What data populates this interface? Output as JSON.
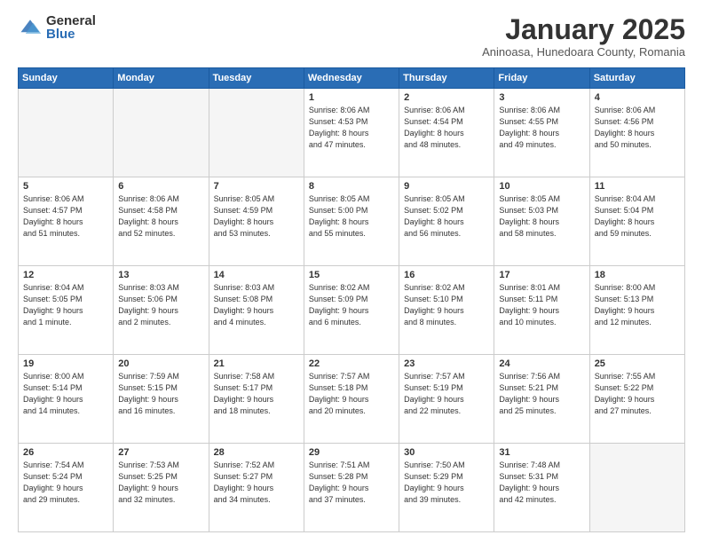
{
  "logo": {
    "general": "General",
    "blue": "Blue"
  },
  "title": "January 2025",
  "subtitle": "Aninoasa, Hunedoara County, Romania",
  "weekdays": [
    "Sunday",
    "Monday",
    "Tuesday",
    "Wednesday",
    "Thursday",
    "Friday",
    "Saturday"
  ],
  "weeks": [
    [
      {
        "day": "",
        "info": ""
      },
      {
        "day": "",
        "info": ""
      },
      {
        "day": "",
        "info": ""
      },
      {
        "day": "1",
        "info": "Sunrise: 8:06 AM\nSunset: 4:53 PM\nDaylight: 8 hours\nand 47 minutes."
      },
      {
        "day": "2",
        "info": "Sunrise: 8:06 AM\nSunset: 4:54 PM\nDaylight: 8 hours\nand 48 minutes."
      },
      {
        "day": "3",
        "info": "Sunrise: 8:06 AM\nSunset: 4:55 PM\nDaylight: 8 hours\nand 49 minutes."
      },
      {
        "day": "4",
        "info": "Sunrise: 8:06 AM\nSunset: 4:56 PM\nDaylight: 8 hours\nand 50 minutes."
      }
    ],
    [
      {
        "day": "5",
        "info": "Sunrise: 8:06 AM\nSunset: 4:57 PM\nDaylight: 8 hours\nand 51 minutes."
      },
      {
        "day": "6",
        "info": "Sunrise: 8:06 AM\nSunset: 4:58 PM\nDaylight: 8 hours\nand 52 minutes."
      },
      {
        "day": "7",
        "info": "Sunrise: 8:05 AM\nSunset: 4:59 PM\nDaylight: 8 hours\nand 53 minutes."
      },
      {
        "day": "8",
        "info": "Sunrise: 8:05 AM\nSunset: 5:00 PM\nDaylight: 8 hours\nand 55 minutes."
      },
      {
        "day": "9",
        "info": "Sunrise: 8:05 AM\nSunset: 5:02 PM\nDaylight: 8 hours\nand 56 minutes."
      },
      {
        "day": "10",
        "info": "Sunrise: 8:05 AM\nSunset: 5:03 PM\nDaylight: 8 hours\nand 58 minutes."
      },
      {
        "day": "11",
        "info": "Sunrise: 8:04 AM\nSunset: 5:04 PM\nDaylight: 8 hours\nand 59 minutes."
      }
    ],
    [
      {
        "day": "12",
        "info": "Sunrise: 8:04 AM\nSunset: 5:05 PM\nDaylight: 9 hours\nand 1 minute."
      },
      {
        "day": "13",
        "info": "Sunrise: 8:03 AM\nSunset: 5:06 PM\nDaylight: 9 hours\nand 2 minutes."
      },
      {
        "day": "14",
        "info": "Sunrise: 8:03 AM\nSunset: 5:08 PM\nDaylight: 9 hours\nand 4 minutes."
      },
      {
        "day": "15",
        "info": "Sunrise: 8:02 AM\nSunset: 5:09 PM\nDaylight: 9 hours\nand 6 minutes."
      },
      {
        "day": "16",
        "info": "Sunrise: 8:02 AM\nSunset: 5:10 PM\nDaylight: 9 hours\nand 8 minutes."
      },
      {
        "day": "17",
        "info": "Sunrise: 8:01 AM\nSunset: 5:11 PM\nDaylight: 9 hours\nand 10 minutes."
      },
      {
        "day": "18",
        "info": "Sunrise: 8:00 AM\nSunset: 5:13 PM\nDaylight: 9 hours\nand 12 minutes."
      }
    ],
    [
      {
        "day": "19",
        "info": "Sunrise: 8:00 AM\nSunset: 5:14 PM\nDaylight: 9 hours\nand 14 minutes."
      },
      {
        "day": "20",
        "info": "Sunrise: 7:59 AM\nSunset: 5:15 PM\nDaylight: 9 hours\nand 16 minutes."
      },
      {
        "day": "21",
        "info": "Sunrise: 7:58 AM\nSunset: 5:17 PM\nDaylight: 9 hours\nand 18 minutes."
      },
      {
        "day": "22",
        "info": "Sunrise: 7:57 AM\nSunset: 5:18 PM\nDaylight: 9 hours\nand 20 minutes."
      },
      {
        "day": "23",
        "info": "Sunrise: 7:57 AM\nSunset: 5:19 PM\nDaylight: 9 hours\nand 22 minutes."
      },
      {
        "day": "24",
        "info": "Sunrise: 7:56 AM\nSunset: 5:21 PM\nDaylight: 9 hours\nand 25 minutes."
      },
      {
        "day": "25",
        "info": "Sunrise: 7:55 AM\nSunset: 5:22 PM\nDaylight: 9 hours\nand 27 minutes."
      }
    ],
    [
      {
        "day": "26",
        "info": "Sunrise: 7:54 AM\nSunset: 5:24 PM\nDaylight: 9 hours\nand 29 minutes."
      },
      {
        "day": "27",
        "info": "Sunrise: 7:53 AM\nSunset: 5:25 PM\nDaylight: 9 hours\nand 32 minutes."
      },
      {
        "day": "28",
        "info": "Sunrise: 7:52 AM\nSunset: 5:27 PM\nDaylight: 9 hours\nand 34 minutes."
      },
      {
        "day": "29",
        "info": "Sunrise: 7:51 AM\nSunset: 5:28 PM\nDaylight: 9 hours\nand 37 minutes."
      },
      {
        "day": "30",
        "info": "Sunrise: 7:50 AM\nSunset: 5:29 PM\nDaylight: 9 hours\nand 39 minutes."
      },
      {
        "day": "31",
        "info": "Sunrise: 7:48 AM\nSunset: 5:31 PM\nDaylight: 9 hours\nand 42 minutes."
      },
      {
        "day": "",
        "info": ""
      }
    ]
  ]
}
